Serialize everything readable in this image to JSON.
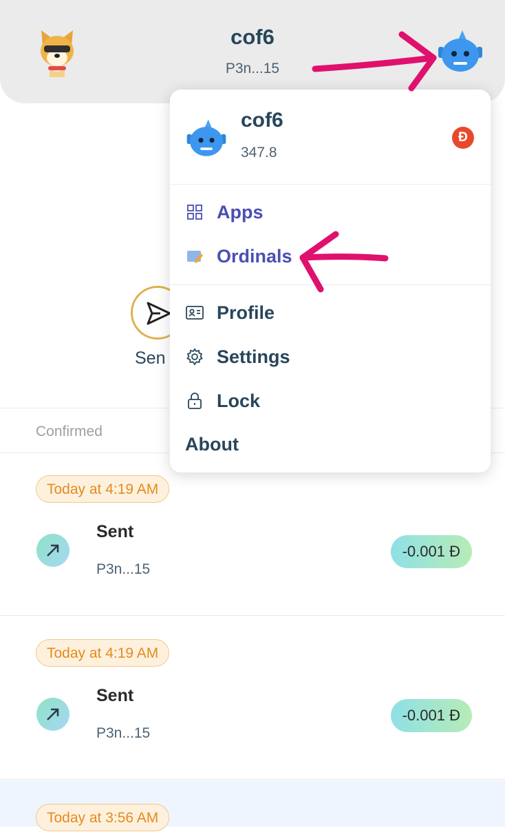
{
  "header": {
    "title": "cof6",
    "address": "P3n...15"
  },
  "actions": {
    "send_label": "Sen"
  },
  "tabs": {
    "confirmed": "Confirmed"
  },
  "transactions": [
    {
      "date": "Today at 4:19 AM",
      "type": "Sent",
      "address": "P3n...15",
      "amount": "-0.001 Ð"
    },
    {
      "date": "Today at 4:19 AM",
      "type": "Sent",
      "address": "P3n...15",
      "amount": "-0.001 Ð"
    },
    {
      "date": "Today at 3:56 AM"
    }
  ],
  "menu": {
    "account_name": "cof6",
    "balance": "347.8",
    "currency_symbol": "Ð",
    "items": [
      {
        "label": "Apps",
        "icon": "grid-icon"
      },
      {
        "label": "Ordinals",
        "icon": "ordinals-icon"
      },
      {
        "label": "Profile",
        "icon": "id-card-icon"
      },
      {
        "label": "Settings",
        "icon": "gear-icon"
      },
      {
        "label": "Lock",
        "icon": "lock-icon"
      },
      {
        "label": "About"
      }
    ]
  },
  "colors": {
    "accent": "#4a4fb3",
    "annotation": "#e0106e",
    "badge_orange": "#e58a20",
    "doge_red": "#e8492d"
  }
}
